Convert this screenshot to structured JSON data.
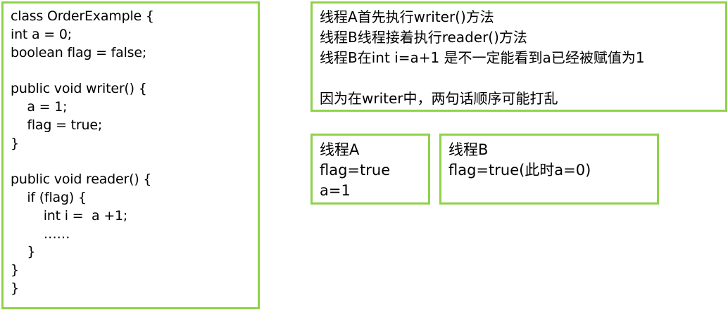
{
  "code_block": {
    "lines": [
      "class OrderExample {",
      "int a = 0;",
      "boolean flag = false;",
      "",
      "public void writer() {",
      "    a = 1;",
      "    flag = true;",
      "}",
      "",
      "public void reader() {",
      "    if (flag) {",
      "        int i =  a +1;",
      "        ……",
      "    }",
      "}",
      "}"
    ]
  },
  "explanation": {
    "lines": [
      "线程A首先执行writer()方法",
      "线程B线程接着执行reader()方法",
      "线程B在int i=a+1 是不一定能看到a已经被赋值为1",
      "",
      "因为在writer中，两句话顺序可能打乱"
    ]
  },
  "thread_a": {
    "title": "线程A",
    "line1": "flag=true",
    "line2": "a=1"
  },
  "thread_b": {
    "title": "线程B",
    "line1": "flag=true(此时a=0)"
  },
  "colors": {
    "border": "#8fd24a",
    "text": "#000000",
    "background": "#ffffff"
  }
}
